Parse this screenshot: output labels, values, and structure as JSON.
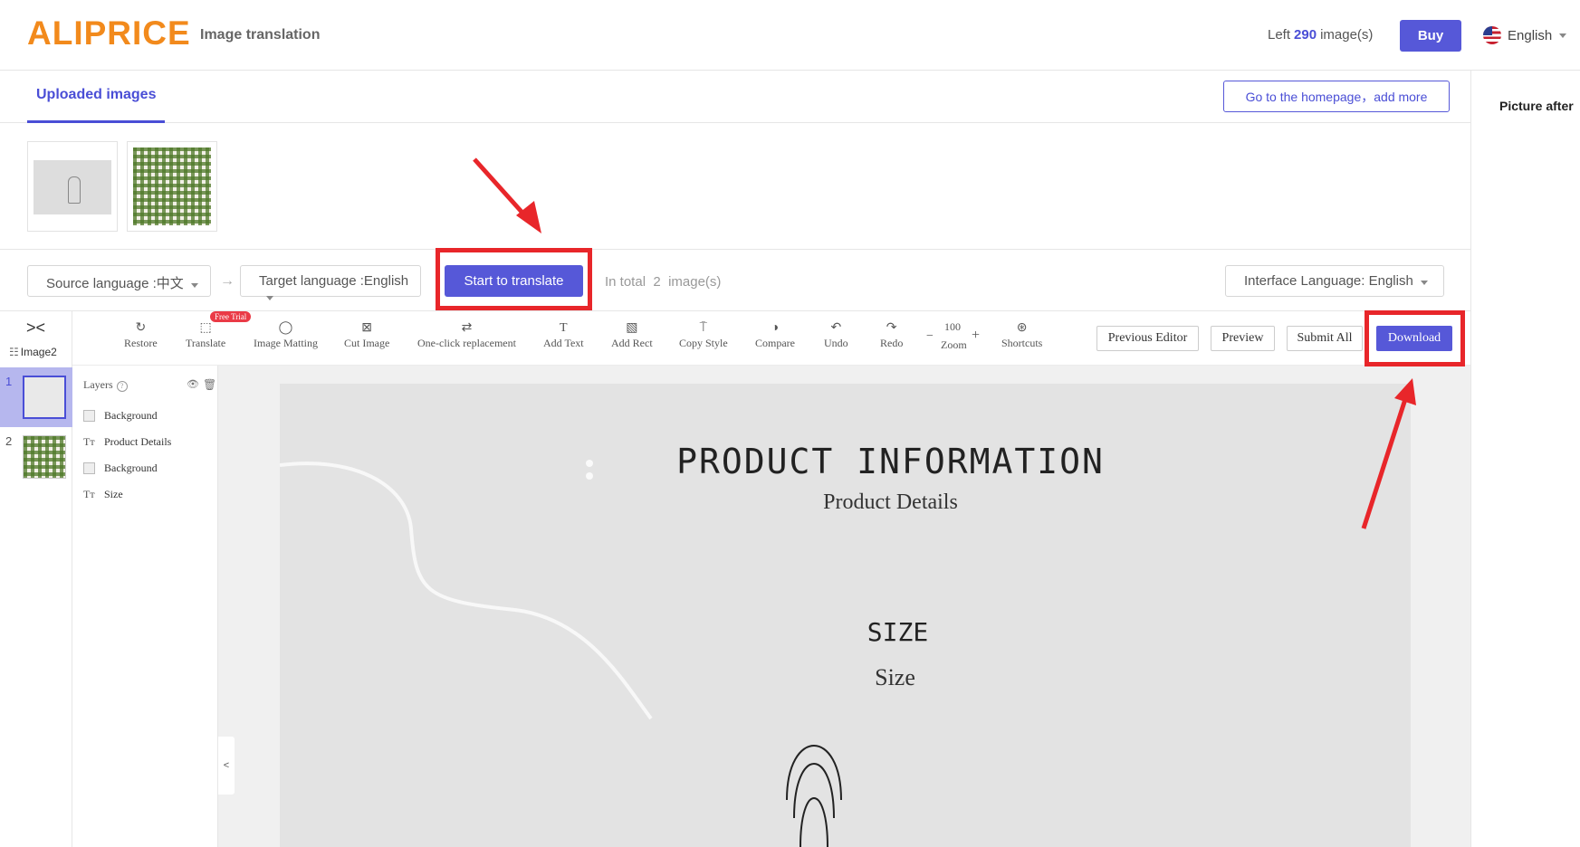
{
  "header": {
    "logo": "ALIPRICE",
    "app_title": "Image translation",
    "quota_prefix": "Left",
    "quota_count": "290",
    "quota_suffix": "image(s)",
    "buy_label": "Buy",
    "language": "English"
  },
  "tabs": {
    "uploaded": "Uploaded images",
    "home_button": "Go to the homepage，add more"
  },
  "language_row": {
    "source": "Source language :中文",
    "target": "Target language :English",
    "start_button": "Start to translate",
    "total_prefix": "In total",
    "total_count": "2",
    "total_suffix": "image(s)",
    "interface_language": "Interface Language: English"
  },
  "editor": {
    "image_count": "Image2",
    "pages": [
      "1",
      "2"
    ],
    "toolbar": {
      "restore": "Restore",
      "translate": "Translate",
      "free_trial": "Free Trial",
      "image_matting": "Image Matting",
      "cut_image": "Cut Image",
      "one_click": "One-click replacement",
      "add_text": "Add Text",
      "add_rect": "Add Rect",
      "copy_style": "Copy Style",
      "compare": "Compare",
      "undo": "Undo",
      "redo": "Redo",
      "zoom_value": "100",
      "zoom": "Zoom",
      "shortcuts": "Shortcuts"
    },
    "buttons": {
      "previous_editor": "Previous Editor",
      "preview": "Preview",
      "submit_all": "Submit All",
      "download": "Download"
    },
    "layers": {
      "title": "Layers",
      "items": [
        {
          "type": "rect",
          "label": "Background"
        },
        {
          "type": "text",
          "label": "Product Details"
        },
        {
          "type": "rect",
          "label": "Background"
        },
        {
          "type": "text",
          "label": "Size"
        }
      ]
    },
    "canvas": {
      "title": "PRODUCT INFORMATION",
      "subtitle": "Product Details",
      "size_heading": "SIZE",
      "size_sub": "Size"
    }
  },
  "right_panel": {
    "title": "Picture after"
  },
  "colors": {
    "brand": "#f28a1c",
    "accent": "#5658d8",
    "highlight": "#e8262a"
  }
}
